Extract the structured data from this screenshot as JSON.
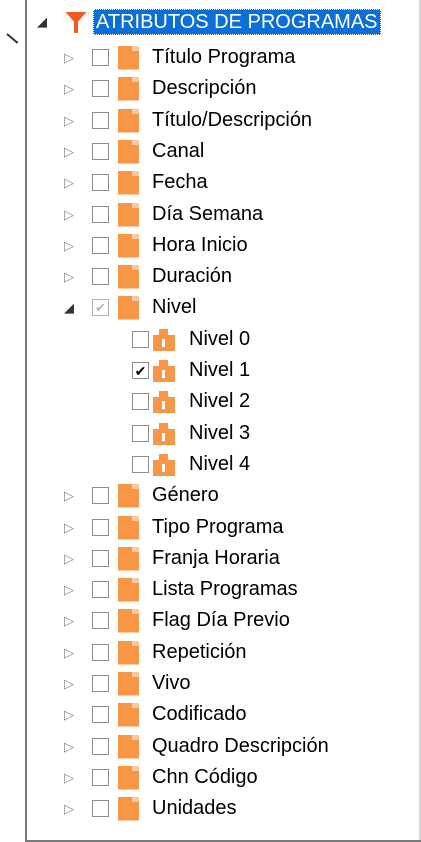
{
  "tree": {
    "root": {
      "label": "ATRIBUTOS DE PROGRAMAS",
      "expanded": true,
      "icon": "funnel-icon"
    },
    "items": [
      {
        "label": "Título Programa",
        "checked": false,
        "expanded": false
      },
      {
        "label": "Descripción",
        "checked": false,
        "expanded": false
      },
      {
        "label": "Título/Descripción",
        "checked": false,
        "expanded": false
      },
      {
        "label": "Canal",
        "checked": false,
        "expanded": false
      },
      {
        "label": "Fecha",
        "checked": false,
        "expanded": false
      },
      {
        "label": "Día Semana",
        "checked": false,
        "expanded": false
      },
      {
        "label": "Hora Inicio",
        "checked": false,
        "expanded": false
      },
      {
        "label": "Duración",
        "checked": false,
        "expanded": false
      },
      {
        "label": "Nivel",
        "checked": "partial",
        "expanded": true,
        "children": [
          {
            "label": "Nivel 0",
            "checked": false
          },
          {
            "label": "Nivel 1",
            "checked": true
          },
          {
            "label": "Nivel 2",
            "checked": false
          },
          {
            "label": "Nivel 3",
            "checked": false
          },
          {
            "label": "Nivel 4",
            "checked": false
          }
        ]
      },
      {
        "label": "Género",
        "checked": false,
        "expanded": false
      },
      {
        "label": "Tipo Programa",
        "checked": false,
        "expanded": false
      },
      {
        "label": "Franja Horaria",
        "checked": false,
        "expanded": false
      },
      {
        "label": "Lista Programas",
        "checked": false,
        "expanded": false
      },
      {
        "label": "Flag Día Previo",
        "checked": false,
        "expanded": false
      },
      {
        "label": "Repetición",
        "checked": false,
        "expanded": false
      },
      {
        "label": "Vivo",
        "checked": false,
        "expanded": false
      },
      {
        "label": "Codificado",
        "checked": false,
        "expanded": false
      },
      {
        "label": "Quadro Descripción",
        "checked": false,
        "expanded": false
      },
      {
        "label": "Chn Código",
        "checked": false,
        "expanded": false
      },
      {
        "label": "Unidades",
        "checked": false,
        "expanded": false
      }
    ]
  },
  "colors": {
    "folder": "#f79646",
    "selection": "#0b6fd6",
    "funnel": "#f15a24"
  }
}
